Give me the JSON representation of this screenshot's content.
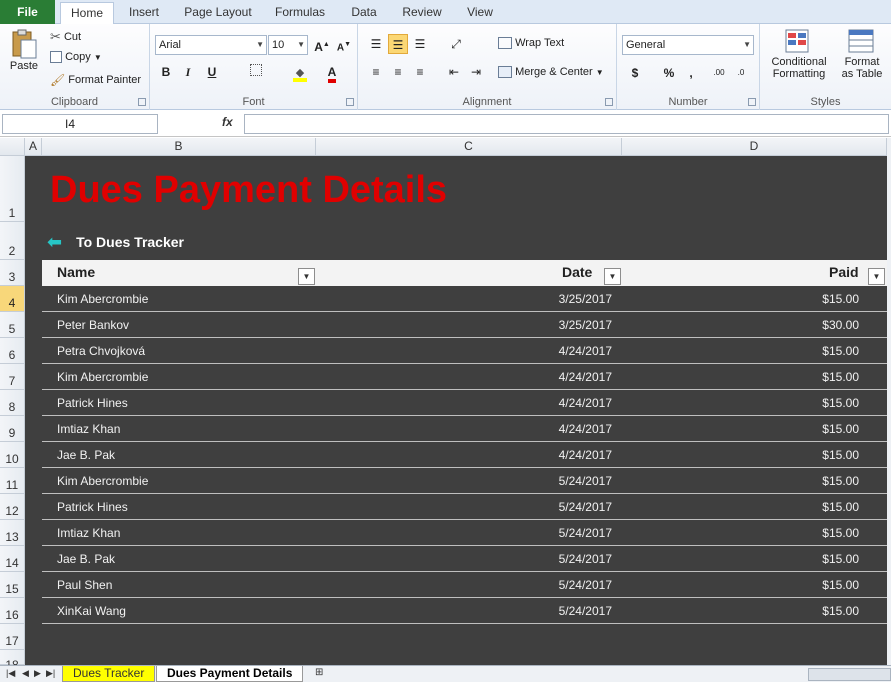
{
  "ribbon": {
    "tabs": [
      "File",
      "Home",
      "Insert",
      "Page Layout",
      "Formulas",
      "Data",
      "Review",
      "View"
    ],
    "active_tab": "Home",
    "clipboard": {
      "paste": "Paste",
      "cut": "Cut",
      "copy": "Copy",
      "format_painter": "Format Painter",
      "label": "Clipboard"
    },
    "font": {
      "name": "Arial",
      "size": "10",
      "label": "Font"
    },
    "alignment": {
      "wrap_text": "Wrap Text",
      "merge_center": "Merge & Center",
      "label": "Alignment"
    },
    "number": {
      "format": "General",
      "label": "Number"
    },
    "styles": {
      "conditional_1": "Conditional",
      "conditional_2": "Formatting",
      "format_table_1": "Format",
      "format_table_2": "as Table",
      "label": "Styles"
    }
  },
  "formula_bar": {
    "name_box": "I4",
    "fx": "fx",
    "value": ""
  },
  "columns": [
    "A",
    "B",
    "C",
    "D"
  ],
  "rows": [
    "1",
    "2",
    "3",
    "4",
    "5",
    "6",
    "7",
    "8",
    "9",
    "10",
    "11",
    "12",
    "13",
    "14",
    "15",
    "16",
    "17",
    "18"
  ],
  "selected_row": "4",
  "sheet": {
    "title": "Dues Payment Details",
    "back_link": "To Dues Tracker",
    "headers": {
      "name": "Name",
      "date": "Date",
      "paid": "Paid"
    },
    "records": [
      {
        "name": "Kim Abercrombie",
        "date": "3/25/2017",
        "paid": "$15.00"
      },
      {
        "name": "Peter Bankov",
        "date": "3/25/2017",
        "paid": "$30.00"
      },
      {
        "name": "Petra Chvojková",
        "date": "4/24/2017",
        "paid": "$15.00"
      },
      {
        "name": "Kim Abercrombie",
        "date": "4/24/2017",
        "paid": "$15.00"
      },
      {
        "name": "Patrick Hines",
        "date": "4/24/2017",
        "paid": "$15.00"
      },
      {
        "name": "Imtiaz Khan",
        "date": "4/24/2017",
        "paid": "$15.00"
      },
      {
        "name": "Jae B. Pak",
        "date": "4/24/2017",
        "paid": "$15.00"
      },
      {
        "name": "Kim Abercrombie",
        "date": "5/24/2017",
        "paid": "$15.00"
      },
      {
        "name": "Patrick Hines",
        "date": "5/24/2017",
        "paid": "$15.00"
      },
      {
        "name": "Imtiaz Khan",
        "date": "5/24/2017",
        "paid": "$15.00"
      },
      {
        "name": "Jae B. Pak",
        "date": "5/24/2017",
        "paid": "$15.00"
      },
      {
        "name": "Paul Shen",
        "date": "5/24/2017",
        "paid": "$15.00"
      },
      {
        "name": "XinKai Wang",
        "date": "5/24/2017",
        "paid": "$15.00"
      }
    ]
  },
  "sheet_tabs": [
    "Dues Tracker",
    "Dues Payment Details"
  ],
  "active_sheet_tab": "Dues Payment Details",
  "colors": {
    "title": "#e00000",
    "sheet_bg": "#3f3f3f",
    "accent_arrow": "#26c6c6",
    "tab_highlight": "#ffff00",
    "file_tab": "#2a7d35"
  }
}
